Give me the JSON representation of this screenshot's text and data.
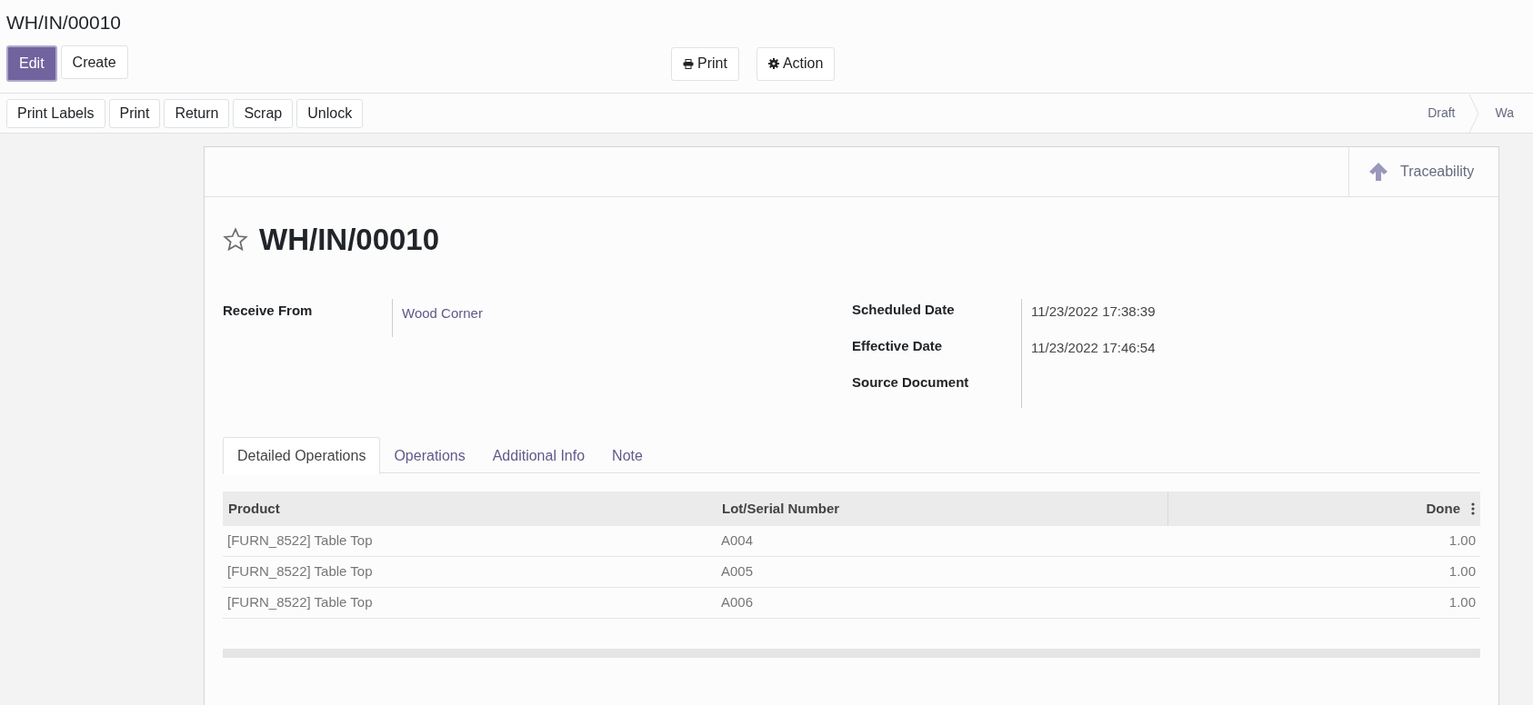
{
  "breadcrumb": "WH/IN/00010",
  "main_buttons": [
    {
      "label": "Edit",
      "kind": "primary"
    },
    {
      "label": "Create",
      "kind": "secondary"
    }
  ],
  "center_buttons": [
    {
      "label": "Print",
      "kind": "print"
    },
    {
      "label": "Action",
      "kind": "gear"
    }
  ],
  "header_buttons": [
    "Print Labels",
    "Print",
    "Return",
    "Scrap",
    "Unlock"
  ],
  "statusbar": [
    {
      "label": "Draft",
      "selected": false
    },
    {
      "label": "Wa",
      "selected": false
    }
  ],
  "smart_button": {
    "label": "Traceability"
  },
  "record": {
    "title": "WH/IN/00010",
    "favorite": false
  },
  "left_fields": [
    {
      "label": "Receive From",
      "value": "Wood Corner",
      "kind": "link"
    }
  ],
  "right_fields": [
    {
      "label": "Scheduled Date",
      "value": "11/23/2022 17:38:39"
    },
    {
      "label": "Effective Date",
      "value": "11/23/2022 17:46:54"
    },
    {
      "label": "Source Document"
    }
  ],
  "tabs": [
    {
      "label": "Detailed Operations",
      "selected": true
    },
    {
      "label": "Operations",
      "selected": false
    },
    {
      "label": "Additional Info",
      "selected": false
    },
    {
      "label": "Note",
      "selected": false
    }
  ],
  "table": {
    "columns": [
      "Product",
      "Lot/Serial Number",
      "Done"
    ],
    "rows": [
      [
        "[FURN_8522] Table Top",
        "A004",
        "1.00"
      ],
      [
        "[FURN_8522] Table Top",
        "A005",
        "1.00"
      ],
      [
        "[FURN_8522] Table Top",
        "A006",
        "1.00"
      ]
    ]
  }
}
